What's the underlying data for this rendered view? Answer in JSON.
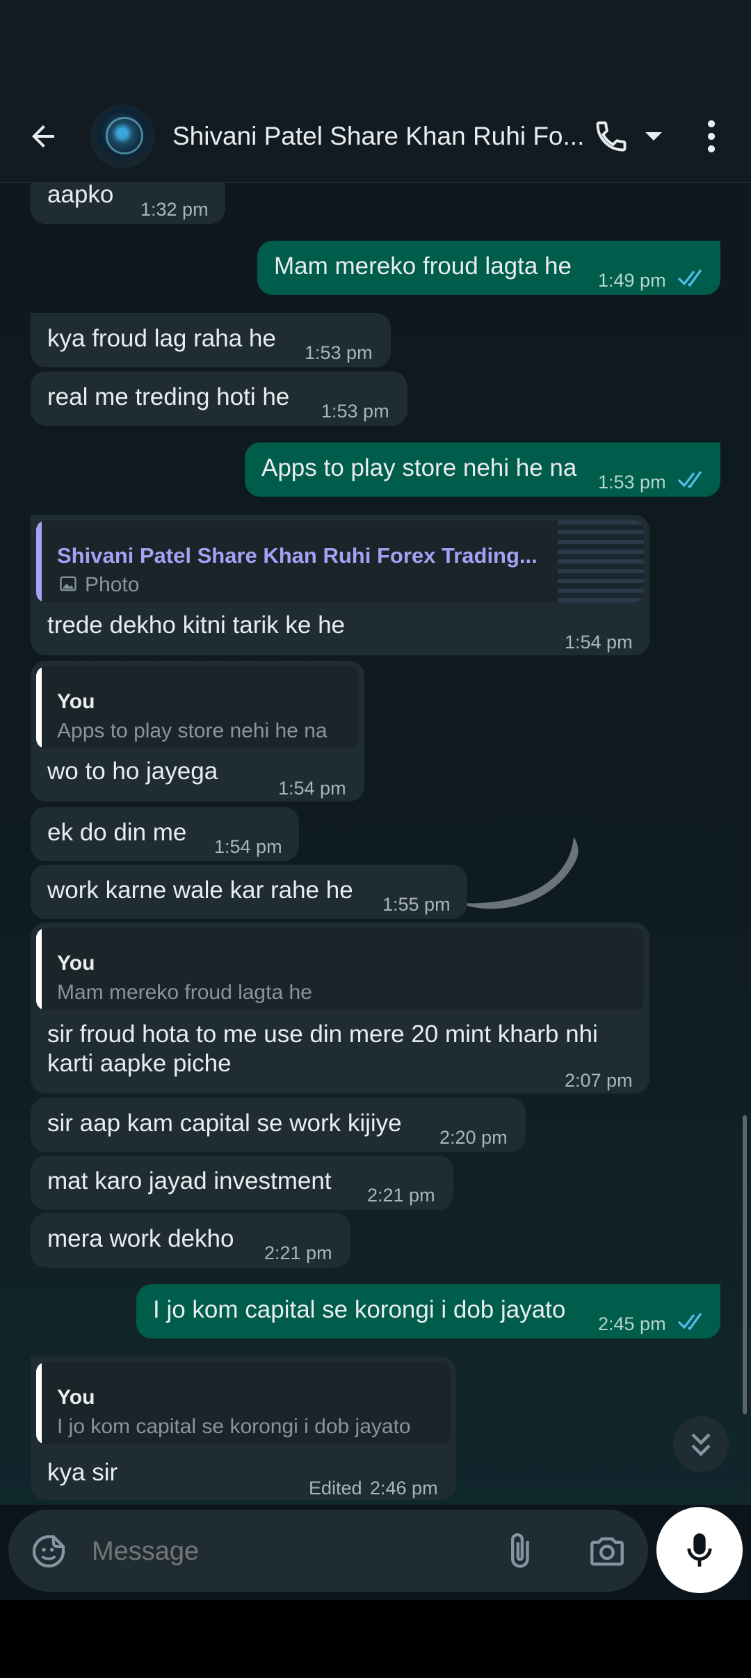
{
  "header": {
    "title": "Shivani Patel Share Khan Ruhi Fo...",
    "icons": [
      "back-arrow-icon",
      "avatar",
      "phone-icon",
      "dropdown-arrow-icon",
      "more-vert-icon"
    ]
  },
  "messages": [
    {
      "dir": "in",
      "text": "aapko",
      "time": "1:32 pm"
    },
    {
      "dir": "out",
      "text": "Mam mereko froud lagta he",
      "time": "1:49 pm"
    },
    {
      "dir": "in",
      "text": "kya froud lag raha he",
      "time": "1:53 pm"
    },
    {
      "dir": "in",
      "text": "real me treding hoti he",
      "time": "1:53 pm"
    },
    {
      "dir": "out",
      "text": "Apps to play store nehi he na",
      "time": "1:53 pm"
    },
    {
      "dir": "in",
      "quote": {
        "name": "Shivani Patel Share Khan Ruhi Forex Trading...",
        "text": "Photo"
      },
      "text": "trede dekho kitni tarik ke he",
      "time": "1:54 pm"
    },
    {
      "dir": "in",
      "quote": {
        "name": "You",
        "text": "Apps to play store nehi he na"
      },
      "text": "wo to ho jayega",
      "time": "1:54 pm"
    },
    {
      "dir": "in",
      "text": "ek do din me",
      "time": "1:54 pm"
    },
    {
      "dir": "in",
      "text": "work karne wale kar rahe he",
      "time": "1:55 pm"
    },
    {
      "dir": "in",
      "quote": {
        "name": "You",
        "text": "Mam mereko froud lagta he"
      },
      "text_line1": "sir froud hota to me use din mere 20 mint kharb nhi",
      "text_line2": "karti aapke piche",
      "time": "2:07 pm"
    },
    {
      "dir": "in",
      "text": "sir aap kam capital se work kijiye",
      "time": "2:20 pm"
    },
    {
      "dir": "in",
      "text": "mat karo jayad investment",
      "time": "2:21 pm"
    },
    {
      "dir": "in",
      "text": "mera work dekho",
      "time": "2:21 pm"
    },
    {
      "dir": "out",
      "text": "I jo kom capital se korongi i dob jayato",
      "time": "2:45 pm"
    },
    {
      "dir": "in",
      "quote": {
        "name": "You",
        "text": "I jo kom capital se korongi i dob jayato"
      },
      "text": "kya sir",
      "edited": "Edited",
      "time": "2:46 pm"
    }
  ],
  "input": {
    "placeholder": "Message"
  },
  "colors": {
    "incoming": "#202c33",
    "outgoing": "#005c4b",
    "read_ticks": "#53bdeb",
    "quote_you": "#ffffff",
    "quote_contact": "#a5a1f5"
  }
}
